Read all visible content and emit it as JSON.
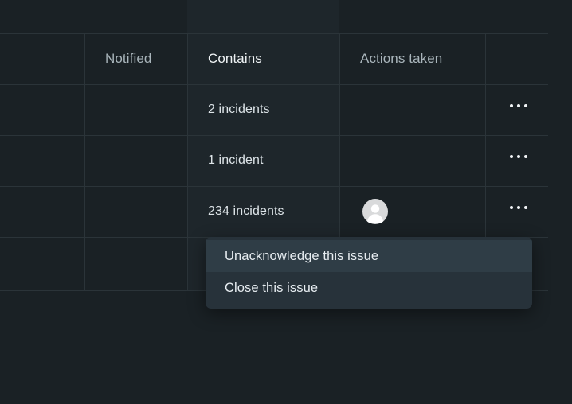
{
  "theme": {
    "background": "#1a2125",
    "grid_line": "#2b3439",
    "highlight_column": "#1e262b",
    "menu_background": "#27323a",
    "menu_item_hover": "#2f3d46",
    "text_primary": "#dde4e8",
    "text_muted": "#a9b5bb",
    "text_bright": "#eef2f4",
    "avatar_fill": "#d9dadb"
  },
  "table": {
    "columns": [
      {
        "key": "spacer_left",
        "label": "",
        "highlighted": false
      },
      {
        "key": "notified",
        "label": "Notified",
        "highlighted": false
      },
      {
        "key": "contains",
        "label": "Contains",
        "highlighted": true
      },
      {
        "key": "actions_taken",
        "label": "Actions taken",
        "highlighted": false
      },
      {
        "key": "row_menu",
        "label": "",
        "highlighted": false
      }
    ],
    "rows": [
      {
        "notified": "",
        "contains": "2 incidents",
        "actions_taken": {
          "avatar": false
        },
        "menu_icon": "ellipsis-icon"
      },
      {
        "notified": "",
        "contains": "1 incident",
        "actions_taken": {
          "avatar": false
        },
        "menu_icon": "ellipsis-icon"
      },
      {
        "notified": "",
        "contains": "234 incidents",
        "actions_taken": {
          "avatar": true,
          "avatar_icon": "user-avatar-placeholder"
        },
        "menu_icon": "ellipsis-icon"
      },
      {
        "notified": "",
        "contains": "",
        "actions_taken": {
          "avatar": false
        },
        "menu_icon": ""
      }
    ]
  },
  "context_menu": {
    "visible": true,
    "items": [
      {
        "label": "Unacknowledge this issue",
        "active": true
      },
      {
        "label": "Close this issue",
        "active": false
      }
    ]
  }
}
